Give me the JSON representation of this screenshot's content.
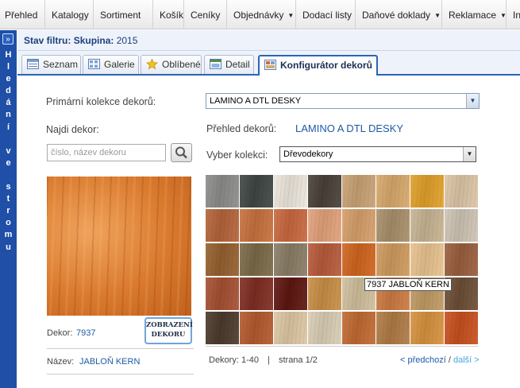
{
  "menu": [
    {
      "label": "Přehled",
      "dropdown": false
    },
    {
      "label": "Katalogy",
      "dropdown": false
    },
    {
      "label": "Sortiment",
      "dropdown": false
    },
    {
      "label": "Košík",
      "dropdown": false
    },
    {
      "label": "Ceníky",
      "dropdown": false
    },
    {
      "label": "Objednávky",
      "dropdown": true
    },
    {
      "label": "Dodací listy",
      "dropdown": false
    },
    {
      "label": "Daňové doklady",
      "dropdown": true
    },
    {
      "label": "Reklamace",
      "dropdown": true
    },
    {
      "label": "In",
      "dropdown": false
    }
  ],
  "sidebar": {
    "expand_icon": "double-chevron-right-icon",
    "vertical_label": [
      "H",
      "l",
      "e",
      "d",
      "á",
      "n",
      "í",
      "",
      "v",
      "e",
      "",
      "s",
      "t",
      "r",
      "o",
      "m",
      "u"
    ]
  },
  "filter": {
    "prefix": "Stav filtru:",
    "key": "Skupina:",
    "value": "2015"
  },
  "tabs": [
    {
      "label": "Seznam",
      "icon": "list-icon",
      "active": false
    },
    {
      "label": "Galerie",
      "icon": "gallery-icon",
      "active": false
    },
    {
      "label": "Oblíbené",
      "icon": "star-icon",
      "active": false
    },
    {
      "label": "Detail",
      "icon": "detail-icon",
      "active": false
    },
    {
      "label": "Konfigurátor dekorů",
      "icon": "configurator-icon",
      "active": true
    }
  ],
  "primary_collection": {
    "label": "Primární kolekce dekorů:",
    "value": "LAMINO A DTL DESKY"
  },
  "find": {
    "label": "Najdi dekor:",
    "placeholder": "číslo, název dekoru"
  },
  "overview": {
    "label": "Přehled dekorů:",
    "value": "LAMINO A DTL DESKY"
  },
  "collection": {
    "label": "Vyber kolekci:",
    "value": "Dřevodekory"
  },
  "selected": {
    "code_label": "Dekor:",
    "code": "7937",
    "name_label": "Název:",
    "name": "JABLOŇ KERN",
    "show_button": "ZOBRAZENÍ DEKORU"
  },
  "tooltip": "7937 JABLOŇ KERN",
  "swatches": [
    "#8c8d8a",
    "#3f4644",
    "#ece6dc",
    "#4a4038",
    "#c9a275",
    "#d7a96b",
    "#e0a02a",
    "#dcc5a6",
    "#b4643a",
    "#c8713e",
    "#c9683f",
    "#e2a17a",
    "#d69f6a",
    "#a88f6a",
    "#c7b492",
    "#cec4b4",
    "#95602e",
    "#7b6a48",
    "#8a7d66",
    "#b85a3a",
    "#d0651e",
    "#cf9a5e",
    "#e8c28e",
    "#9a5e3e",
    "#a65032",
    "#7f2d22",
    "#5e1610",
    "#c98e46",
    "#cfbf9c",
    "#cd7a42",
    "#c09a64",
    "#6c4e36",
    "#4c3a2d",
    "#b45a2e",
    "#ddc7a2",
    "#d9cdb4",
    "#c16a32",
    "#b07b45",
    "#d6923e",
    "#c8501e"
  ],
  "pager": {
    "range": "Dekory: 1-40",
    "sep": "|",
    "page": "strana  1/2",
    "prev": "< předchozí",
    "slash": "/",
    "next": "další >"
  }
}
